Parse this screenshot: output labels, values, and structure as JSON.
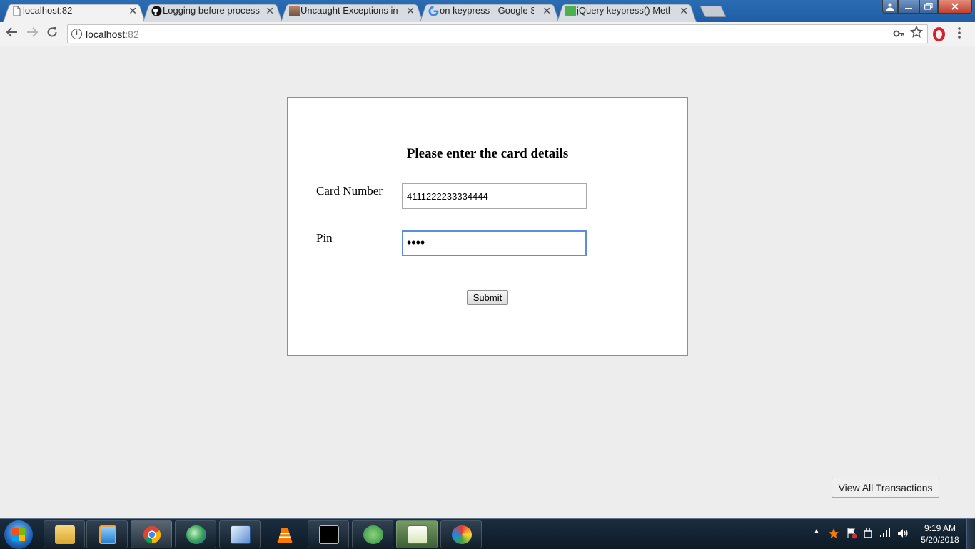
{
  "browser": {
    "tabs": [
      {
        "title": "localhost:82",
        "icon": "page-icon",
        "active": true
      },
      {
        "title": "Logging before processi",
        "icon": "github-icon",
        "active": false
      },
      {
        "title": "Uncaught Exceptions in N",
        "icon": "avatar-icon",
        "active": false
      },
      {
        "title": "on keypress - Google Sea",
        "icon": "google-icon",
        "active": false
      },
      {
        "title": "jQuery keypress() Metho",
        "icon": "w3schools-icon",
        "active": false
      }
    ],
    "close_glyph": "✕",
    "address": {
      "host": "localhost",
      "port": ":82"
    }
  },
  "form": {
    "heading": "Please enter the card details",
    "card_label": "Card Number",
    "card_value": "4111222233334444",
    "pin_label": "Pin",
    "pin_value": "••••",
    "submit_label": "Submit"
  },
  "page": {
    "view_all_label": "View All Transactions"
  },
  "taskbar": {
    "apps": [
      "file-explorer-icon",
      "media-player-icon",
      "chrome-icon",
      "network-globe-icon",
      "virtualbox-icon",
      "vlc-icon",
      "cmd-icon",
      "android-studio-icon",
      "notepad-plus-plus-icon",
      "paint-icon"
    ],
    "time": "9:19 AM",
    "date": "5/20/2018"
  },
  "colors": {
    "tab_strip": "#1f5ea6",
    "focus_ring": "#5b8edc",
    "opera_red": "#d81e28"
  }
}
